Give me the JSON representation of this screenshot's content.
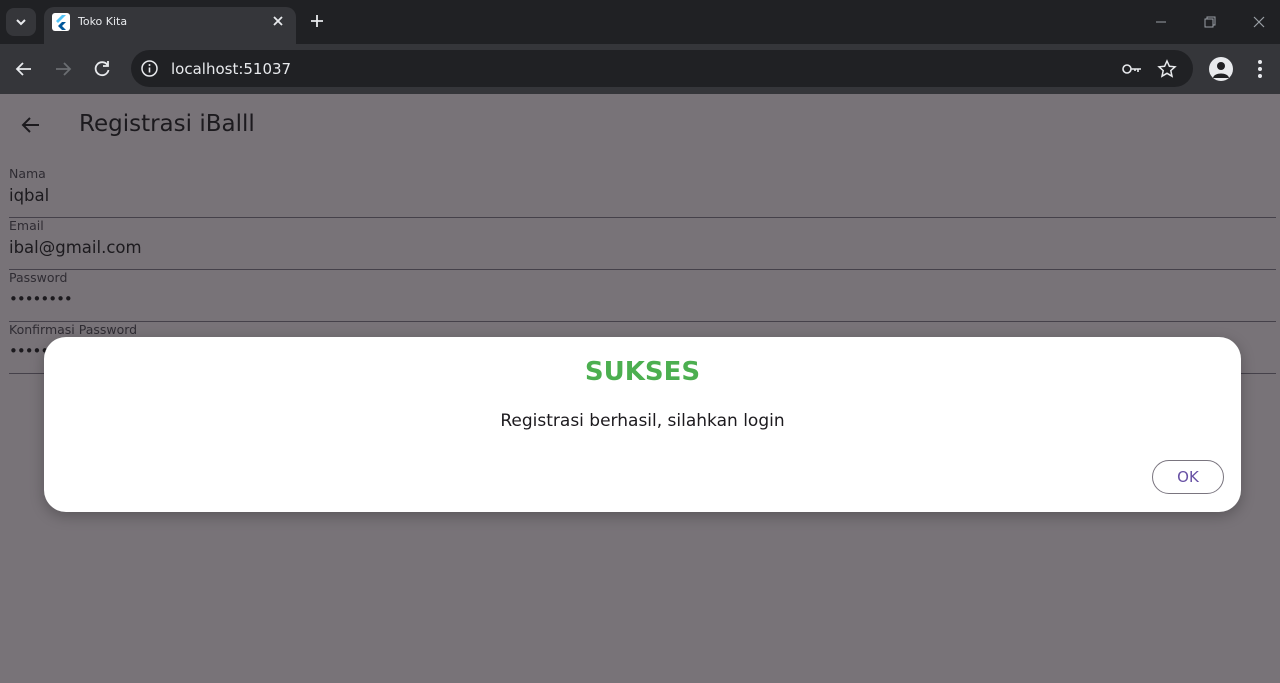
{
  "browser": {
    "tab": {
      "title": "Toko Kita",
      "favicon": "flutter-logo-icon"
    },
    "url": "localhost:51037",
    "icons": [
      "tab-search-icon",
      "close-icon",
      "plus-icon",
      "minimize-icon",
      "restore-icon",
      "window-close-icon",
      "back-arrow-icon",
      "forward-arrow-icon",
      "reload-icon",
      "info-icon",
      "key-icon",
      "star-icon",
      "profile-icon",
      "more-vert-icon"
    ]
  },
  "app": {
    "appbar": {
      "title": "Registrasi iBalll",
      "back_icon": "arrow-back-icon"
    },
    "form": {
      "fields": [
        {
          "label": "Nama",
          "value": "iqbal"
        },
        {
          "label": "Email",
          "value": "ibal@gmail.com"
        },
        {
          "label": "Password",
          "value": "••••••••"
        },
        {
          "label": "Konfirmasi Password",
          "value": "••••••••"
        }
      ]
    }
  },
  "dialog": {
    "title": "SUKSES",
    "content": "Registrasi berhasil, silahkan login",
    "ok_label": "OK"
  },
  "colors": {
    "success_title": "#4caf50",
    "button_text": "#6750a4",
    "scrim_page": "#787378",
    "chrome_dark": "#202124",
    "chrome_toolbar": "#35363a"
  }
}
